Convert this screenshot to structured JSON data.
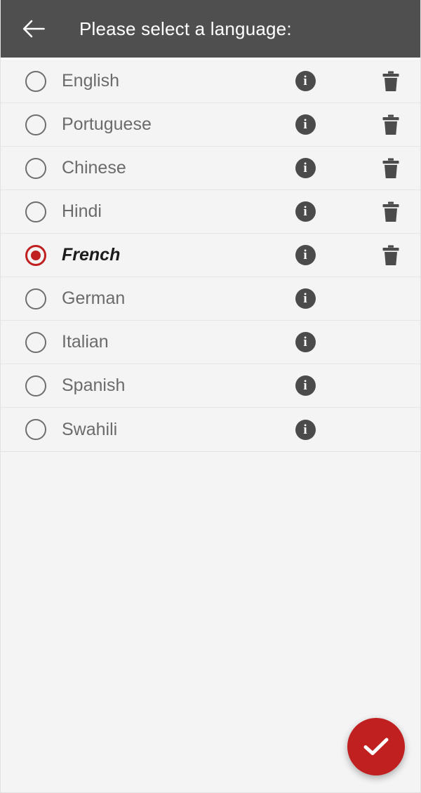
{
  "header": {
    "title": "Please select a language:",
    "back_icon": "arrow-left-icon",
    "background_color": "#4f4f4f",
    "text_color": "#ffffff"
  },
  "colors": {
    "accent": "#c0201f",
    "page_background": "#f4f4f4",
    "row_text": "#6b6b6b",
    "selected_row_text": "#1c1c1c",
    "icon_dark": "#4b4b4b",
    "divider": "#e6e6e6"
  },
  "list": {
    "info_icon": "info-icon",
    "delete_icon": "trash-icon",
    "items": [
      {
        "label": "English",
        "selected": false,
        "has_info": true,
        "has_delete": true
      },
      {
        "label": "Portuguese",
        "selected": false,
        "has_info": true,
        "has_delete": true
      },
      {
        "label": "Chinese",
        "selected": false,
        "has_info": true,
        "has_delete": true
      },
      {
        "label": "Hindi",
        "selected": false,
        "has_info": true,
        "has_delete": true
      },
      {
        "label": "French",
        "selected": true,
        "has_info": true,
        "has_delete": true
      },
      {
        "label": "German",
        "selected": false,
        "has_info": true,
        "has_delete": false
      },
      {
        "label": "Italian",
        "selected": false,
        "has_info": true,
        "has_delete": false
      },
      {
        "label": "Spanish",
        "selected": false,
        "has_info": true,
        "has_delete": false
      },
      {
        "label": "Swahili",
        "selected": false,
        "has_info": true,
        "has_delete": false
      }
    ]
  },
  "fab": {
    "icon": "check-icon",
    "color": "#c0201f"
  }
}
